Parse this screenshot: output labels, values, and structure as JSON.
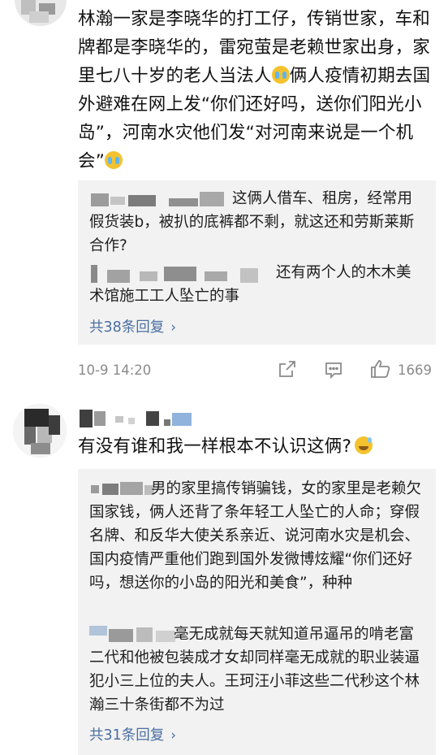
{
  "comment1": {
    "text": "林瀚一家是李晓华的打工仔，传销世家，车和牌都是李晓华的，雷宛萤是老赖世家出身，家里七八十岁的老人当法人",
    "text_part2": "俩人疫情初期去国外避难在网上发“你们还好吗，送你们阳光小岛”，河南水灾他们发“对河南来说是一个机会”",
    "emoji1": "crying-face-emoji",
    "emoji2": "crying-face-emoji",
    "replies": [
      {
        "text": "这俩人借车、租房，经常用假货装b，被扒的底裤都不剩，就这还和劳斯莱斯合作?"
      },
      {
        "text": "还有两个人的木木美术馆施工工人坠亡的事"
      }
    ],
    "more_replies": "共38条回复",
    "timestamp": "10-9 14:20",
    "like_count": "1669"
  },
  "comment2": {
    "text": "有没有谁和我一样根本不认识这俩?",
    "emoji": "sweat-smile-emoji",
    "replies": [
      {
        "text": "男的家里搞传销骗钱，女的家里是老赖欠国家钱，俩人还背了条年轻工人坠亡的人命；穿假名牌、和反华大使关系亲近、说河南水灾是机会、国内疫情严重他们跑到国外发微博炫耀“你们还好吗，想送你的小岛的阳光和美食”，种种"
      },
      {
        "text": "毫无成就每天就知道吊逼吊的啃老富二代和他被包装成才女却同样毫无成就的职业装逼犯小三上位的夫人。王珂汪小菲这些二代秒这个林瀚三十条街都不为过"
      }
    ],
    "more_replies": "共31条回复"
  },
  "colors": {
    "link": "#4a6fa1",
    "meta": "#8a8a8a",
    "reply_bg": "#f2f2f2"
  },
  "icons": [
    "share-icon",
    "comment-icon",
    "like-icon",
    "chevron-right-icon"
  ]
}
